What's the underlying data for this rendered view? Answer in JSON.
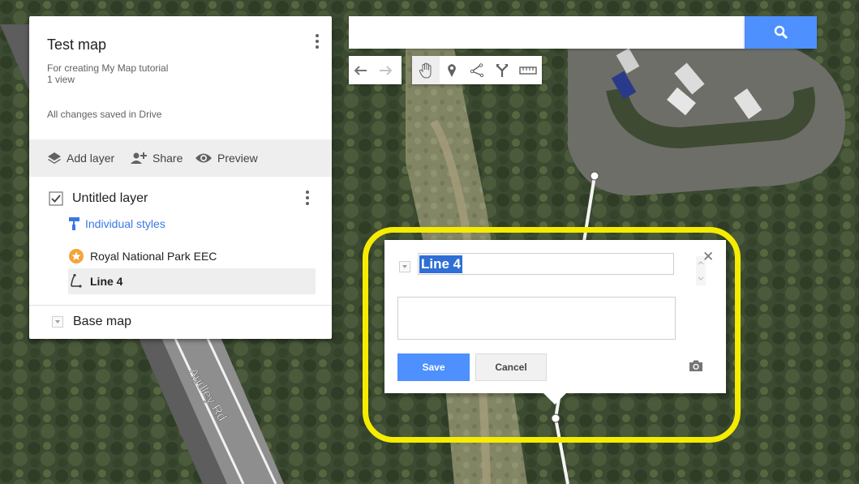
{
  "map": {
    "road_label": "Audley Rd"
  },
  "panel": {
    "title": "Test map",
    "description": "For creating My Map tutorial",
    "views": "1 view",
    "saved_status": "All changes saved in Drive",
    "toolbar": {
      "add_layer": "Add layer",
      "share": "Share",
      "preview": "Preview"
    },
    "layer": {
      "name": "Untitled layer",
      "checked": true,
      "styles_label": "Individual styles",
      "features": [
        {
          "label": "Royal National Park EEC",
          "icon": "star-marker-icon",
          "color": "#f4a43c"
        },
        {
          "label": "Line 4",
          "icon": "line-icon",
          "selected": true
        }
      ]
    },
    "base_map": "Base map"
  },
  "search": {
    "value": "",
    "placeholder": ""
  },
  "map_tools": [
    {
      "name": "undo-icon"
    },
    {
      "name": "redo-icon"
    },
    {
      "name": "pan-hand-icon",
      "selected": true
    },
    {
      "name": "add-marker-icon"
    },
    {
      "name": "draw-line-icon"
    },
    {
      "name": "directions-icon"
    },
    {
      "name": "measure-ruler-icon"
    }
  ],
  "info_window": {
    "title_value": "Line 4",
    "description_value": "",
    "save_label": "Save",
    "cancel_label": "Cancel",
    "close_label": "✕"
  },
  "colors": {
    "accent_blue": "#4d90fe",
    "link_blue": "#3b78e7",
    "highlight_yellow": "#f5ec00",
    "selection_blue": "#2f6fd6"
  }
}
